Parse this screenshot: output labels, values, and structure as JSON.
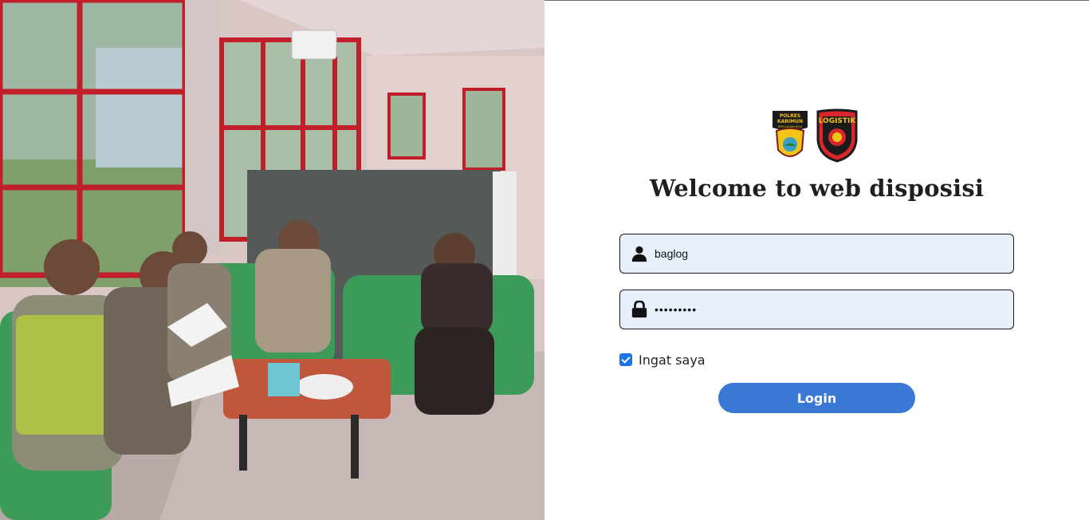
{
  "photo": {
    "description_icon": "group-photo",
    "colors": {
      "wall": "#d9c7c6",
      "frame": "#c01f2a",
      "sofa": "#3d9b5a",
      "partition": "#555a58",
      "floor": "#b9aaa8"
    }
  },
  "logos": [
    {
      "icon": "polres-karimun-badge-icon",
      "text_top": "POLRES",
      "text_mid": "KARIMUN",
      "text_low": "KEPULAUAN RIAU"
    },
    {
      "icon": "logistik-badge-icon",
      "text": "LOGISTIK"
    }
  ],
  "login": {
    "title": "Welcome to web disposisi",
    "username": {
      "icon": "user-icon",
      "value": "baglog"
    },
    "password": {
      "icon": "lock-icon",
      "value": "•••••••••"
    },
    "remember": {
      "checked": true,
      "label": "Ingat saya"
    },
    "submit_label": "Login"
  },
  "colors": {
    "accent": "#3a78d6",
    "field_bg": "#e8f0fe",
    "checkbox": "#1a73e8"
  }
}
